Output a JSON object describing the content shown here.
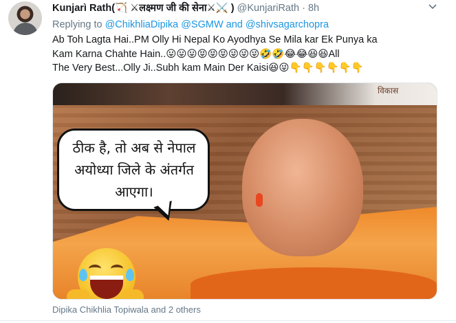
{
  "tweet": {
    "display_name": "Kunjarì Rath(🏹 ⚔लक्ष्मण जी की सेना⚔⚔️ )",
    "handle": "@KunjariRath",
    "separator": "·",
    "time": "8h",
    "menu_icon": "chevron-down-icon",
    "reply": {
      "prefix": "Replying to",
      "mentions": [
        "@ChikhliaDipika",
        "@SGMW",
        "@shivsagarchopra"
      ],
      "joiner": "and"
    },
    "text_line1": "Ab Toh Lagta Hai..PM Olly Hi Nepal Ko Ayodhya Se  Mila kar  Ek Punya ka",
    "text_line2": "Kam Karna Chahte Hain..😛😛😛😝😝😝😜😜😜🤣🤣😂😂😆😆All",
    "text_line3": "The Very Best...Olly Ji..Subh kam Main Der Kaisi😆😜👇👇👇👇👇👇",
    "media": {
      "speech_bubble_text": "ठीक है, तो अब से नेपाल अयोध्या जिले के अंतर्गत आएगा।",
      "watermark": "विकास",
      "emoji": "laughing-face-icon"
    },
    "liked_by": "Dipika Chikhlia Topiwala and 2 others"
  },
  "colors": {
    "accent": "#1b95e0",
    "secondary_text": "#657786",
    "primary_text": "#14171a"
  }
}
